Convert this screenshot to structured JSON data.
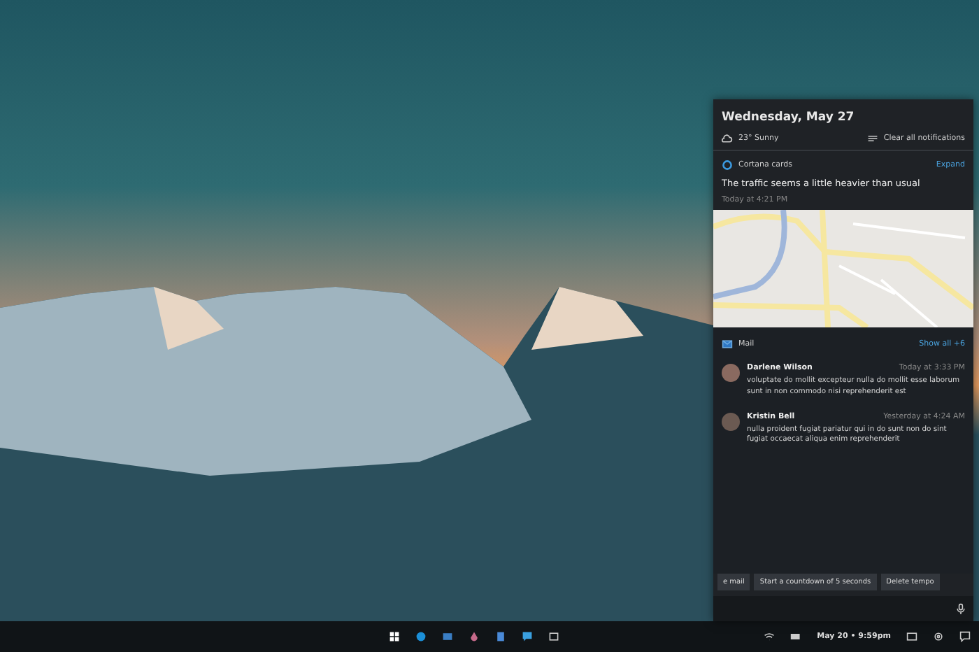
{
  "panel": {
    "date": "Wednesday, May 27",
    "weather": "23° Sunny",
    "clear_all": "Clear all notifications",
    "cortana": {
      "source": "Cortana cards",
      "expand": "Expand",
      "title": "The traffic seems a little heavier than usual",
      "time": "Today at 4:21 PM"
    },
    "mail": {
      "source": "Mail",
      "show_all": "Show all +6",
      "messages": [
        {
          "sender": "Darlene Wilson",
          "time": "Today at 3:33 PM",
          "body": "voluptate do mollit excepteur nulla do mollit esse laborum sunt in non commodo nisi reprehenderit est"
        },
        {
          "sender": "Kristin Bell",
          "time": "Yesterday at 4:24 AM",
          "body": "nulla proident fugiat pariatur qui in do sunt non do sint fugiat occaecat aliqua enim reprehenderit"
        }
      ]
    },
    "suggestions": [
      {
        "label": "e mail"
      },
      {
        "label": "Start a countdown of 5 seconds"
      },
      {
        "label": "Delete tempo"
      }
    ]
  },
  "taskbar": {
    "clock": "May 20 • 9:59pm"
  }
}
